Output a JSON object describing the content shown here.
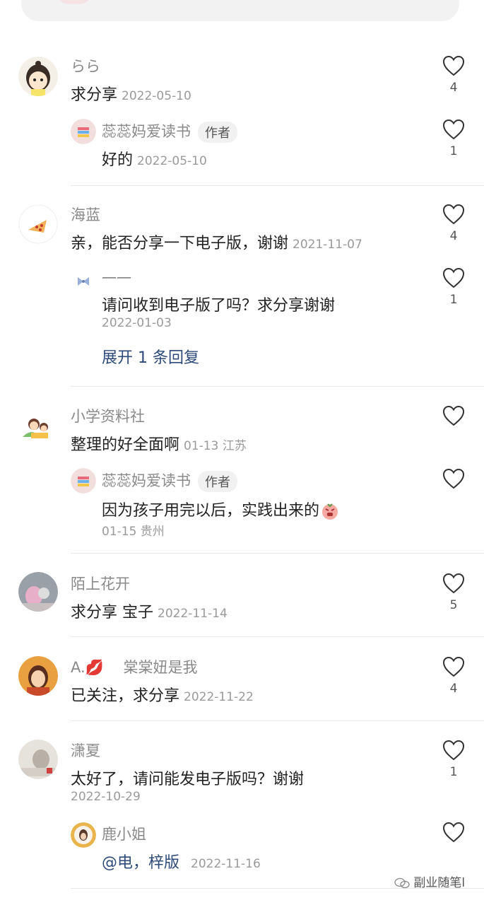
{
  "comments": [
    {
      "name": "らら",
      "text": "求分享",
      "date": "2022-05-10",
      "likes": "4",
      "reply": {
        "name": "蕊蕊妈爱读书",
        "badge": "作者",
        "text": "好的",
        "date": "2022-05-10",
        "likes": "1"
      }
    },
    {
      "name": "海蓝",
      "text": "亲，能否分享一下电子版，谢谢",
      "date": "2021-11-07",
      "likes": "4",
      "reply": {
        "name": "一一",
        "text": "请问收到电子版了吗？求分享谢谢",
        "date": "2022-01-03",
        "likes": "1"
      },
      "expand": "展开 1 条回复"
    },
    {
      "name": "小学资料社",
      "text": "整理的好全面啊",
      "date": "01-13 江苏",
      "reply": {
        "name": "蕊蕊妈爱读书",
        "badge": "作者",
        "text": "因为孩子用完以后，实践出来的",
        "date": "01-15 贵州"
      }
    },
    {
      "name": "陌上花开",
      "text": "求分享 宝子",
      "date": "2022-11-14",
      "likes": "5"
    },
    {
      "name": "A.💋　 棠棠妞是我",
      "text": "已关注，求分享",
      "date": "2022-11-22",
      "likes": "4"
    },
    {
      "name": "潇夏",
      "text": "太好了，请问能发电子版吗？谢谢",
      "date": "2022-10-29",
      "likes": "1",
      "reply": {
        "name": "鹿小姐",
        "text": "@电，梓版",
        "date": "2022-11-16"
      }
    }
  ],
  "watermark": "副业随笔l",
  "colors": {
    "link": "#2d4a7a",
    "meta": "#9a9a9a",
    "name": "#8a8a8a"
  }
}
